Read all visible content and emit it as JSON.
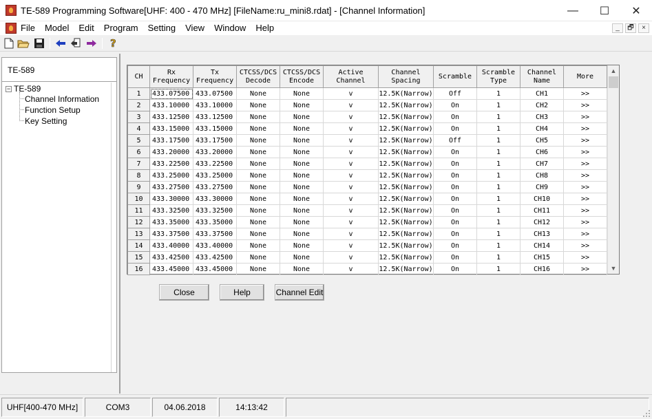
{
  "window": {
    "title": "TE-589 Programming Software[UHF: 400 - 470 MHz] [FileName:ru_mini8.rdat] - [Channel Information]",
    "controls": {
      "minimize": "—",
      "maximize": "☐",
      "close": "✕"
    }
  },
  "menu": {
    "items": [
      "File",
      "Model",
      "Edit",
      "Program",
      "Setting",
      "View",
      "Window",
      "Help"
    ],
    "mdi_controls": {
      "minimize": "_",
      "restore": "🗗",
      "close": "×"
    }
  },
  "toolbar": {
    "icons": [
      "new-file-icon",
      "open-folder-icon",
      "save-icon",
      "read-from-radio-icon",
      "import-icon",
      "write-to-radio-icon",
      "help-icon"
    ]
  },
  "sidebar": {
    "header": "TE-589",
    "tree": {
      "root": "TE-589",
      "expander": "−",
      "children": [
        "Channel Information",
        "Function Setup",
        "Key Setting"
      ]
    }
  },
  "table": {
    "headers": [
      [
        "CH"
      ],
      [
        "Rx",
        "Frequency"
      ],
      [
        "Tx",
        "Frequency"
      ],
      [
        "CTCSS/DCS",
        "Decode"
      ],
      [
        "CTCSS/DCS",
        "Encode"
      ],
      [
        "Active",
        "Channel"
      ],
      [
        "Channel",
        "Spacing"
      ],
      [
        "Scramble"
      ],
      [
        "Scramble",
        "Type"
      ],
      [
        "Channel",
        "Name"
      ],
      [
        "More"
      ]
    ],
    "rows": [
      [
        "1",
        "433.07500",
        "433.07500",
        "None",
        "None",
        "v",
        "12.5K(Narrow)",
        "Off",
        "1",
        "CH1",
        ">>"
      ],
      [
        "2",
        "433.10000",
        "433.10000",
        "None",
        "None",
        "v",
        "12.5K(Narrow)",
        "On",
        "1",
        "CH2",
        ">>"
      ],
      [
        "3",
        "433.12500",
        "433.12500",
        "None",
        "None",
        "v",
        "12.5K(Narrow)",
        "On",
        "1",
        "CH3",
        ">>"
      ],
      [
        "4",
        "433.15000",
        "433.15000",
        "None",
        "None",
        "v",
        "12.5K(Narrow)",
        "On",
        "1",
        "CH4",
        ">>"
      ],
      [
        "5",
        "433.17500",
        "433.17500",
        "None",
        "None",
        "v",
        "12.5K(Narrow)",
        "Off",
        "1",
        "CH5",
        ">>"
      ],
      [
        "6",
        "433.20000",
        "433.20000",
        "None",
        "None",
        "v",
        "12.5K(Narrow)",
        "On",
        "1",
        "CH6",
        ">>"
      ],
      [
        "7",
        "433.22500",
        "433.22500",
        "None",
        "None",
        "v",
        "12.5K(Narrow)",
        "On",
        "1",
        "CH7",
        ">>"
      ],
      [
        "8",
        "433.25000",
        "433.25000",
        "None",
        "None",
        "v",
        "12.5K(Narrow)",
        "On",
        "1",
        "CH8",
        ">>"
      ],
      [
        "9",
        "433.27500",
        "433.27500",
        "None",
        "None",
        "v",
        "12.5K(Narrow)",
        "On",
        "1",
        "CH9",
        ">>"
      ],
      [
        "10",
        "433.30000",
        "433.30000",
        "None",
        "None",
        "v",
        "12.5K(Narrow)",
        "On",
        "1",
        "CH10",
        ">>"
      ],
      [
        "11",
        "433.32500",
        "433.32500",
        "None",
        "None",
        "v",
        "12.5K(Narrow)",
        "On",
        "1",
        "CH11",
        ">>"
      ],
      [
        "12",
        "433.35000",
        "433.35000",
        "None",
        "None",
        "v",
        "12.5K(Narrow)",
        "On",
        "1",
        "CH12",
        ">>"
      ],
      [
        "13",
        "433.37500",
        "433.37500",
        "None",
        "None",
        "v",
        "12.5K(Narrow)",
        "On",
        "1",
        "CH13",
        ">>"
      ],
      [
        "14",
        "433.40000",
        "433.40000",
        "None",
        "None",
        "v",
        "12.5K(Narrow)",
        "On",
        "1",
        "CH14",
        ">>"
      ],
      [
        "15",
        "433.42500",
        "433.42500",
        "None",
        "None",
        "v",
        "12.5K(Narrow)",
        "On",
        "1",
        "CH15",
        ">>"
      ],
      [
        "16",
        "433.45000",
        "433.45000",
        "None",
        "None",
        "v",
        "12.5K(Narrow)",
        "On",
        "1",
        "CH16",
        ">>"
      ]
    ],
    "scroll": {
      "up": "▲",
      "down": "▼"
    }
  },
  "buttons": {
    "close": "Close",
    "help": "Help",
    "channel_edit": "Channel Edit"
  },
  "statusbar": {
    "band": "UHF[400-470 MHz]",
    "port": "COM3",
    "date": "04.06.2018",
    "time": "14:13:42"
  },
  "colors": {
    "app_icon": "#c0392b",
    "arrow_blue": "#1f3fbf",
    "arrow_purple": "#8e2a9e",
    "help_yellow": "#d4a017"
  }
}
